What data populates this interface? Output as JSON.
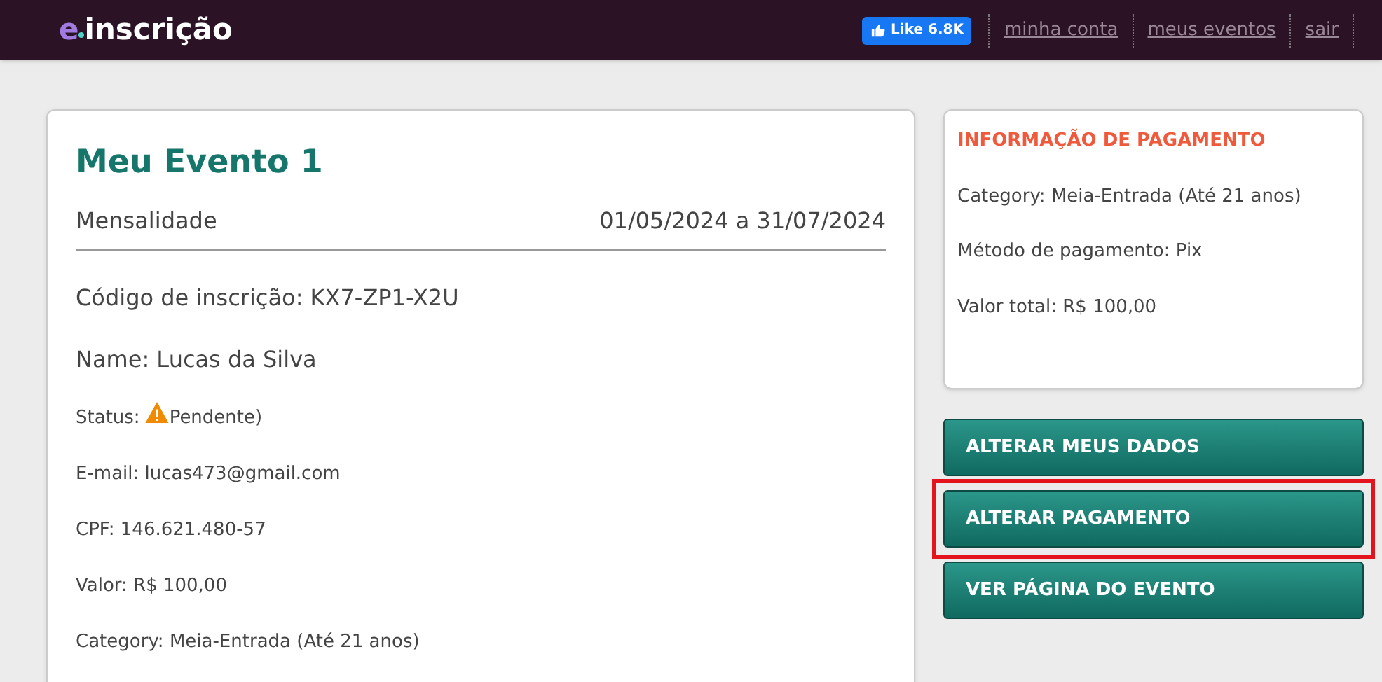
{
  "header": {
    "logo": {
      "mark": "e",
      "text": "inscrição"
    },
    "like_button": {
      "label": "Like",
      "count": "6.8K"
    },
    "nav_links": [
      "minha conta",
      "meus eventos",
      "sair"
    ]
  },
  "event_card": {
    "title": "Meu Evento 1",
    "subtitle": "Mensalidade",
    "dates": "01/05/2024 a 31/07/2024",
    "fields": [
      {
        "kind": "large",
        "text": "Código de inscrição: KX7-ZP1-X2U"
      },
      {
        "kind": "large",
        "text": "Name: Lucas da Silva"
      },
      {
        "kind": "status",
        "label": "Status:",
        "text": "Pendente)"
      },
      {
        "kind": "small",
        "text": "E-mail: lucas473@gmail.com"
      },
      {
        "kind": "small",
        "text": "CPF: 146.621.480-57"
      },
      {
        "kind": "small",
        "text": "Valor: R$ 100,00"
      },
      {
        "kind": "small",
        "text": "Category: Meia-Entrada (Até 21 anos)"
      }
    ]
  },
  "payment_card": {
    "title": "INFORMAÇÃO DE PAGAMENTO",
    "lines": [
      "Category: Meia-Entrada (Até 21 anos)",
      "Método de pagamento: Pix",
      "Valor total: R$ 100,00"
    ]
  },
  "buttons": [
    {
      "label": "ALTERAR MEUS DADOS",
      "highlighted": false
    },
    {
      "label": "ALTERAR PAGAMENTO",
      "highlighted": true
    },
    {
      "label": "VER PÁGINA DO EVENTO",
      "highlighted": false
    }
  ]
}
